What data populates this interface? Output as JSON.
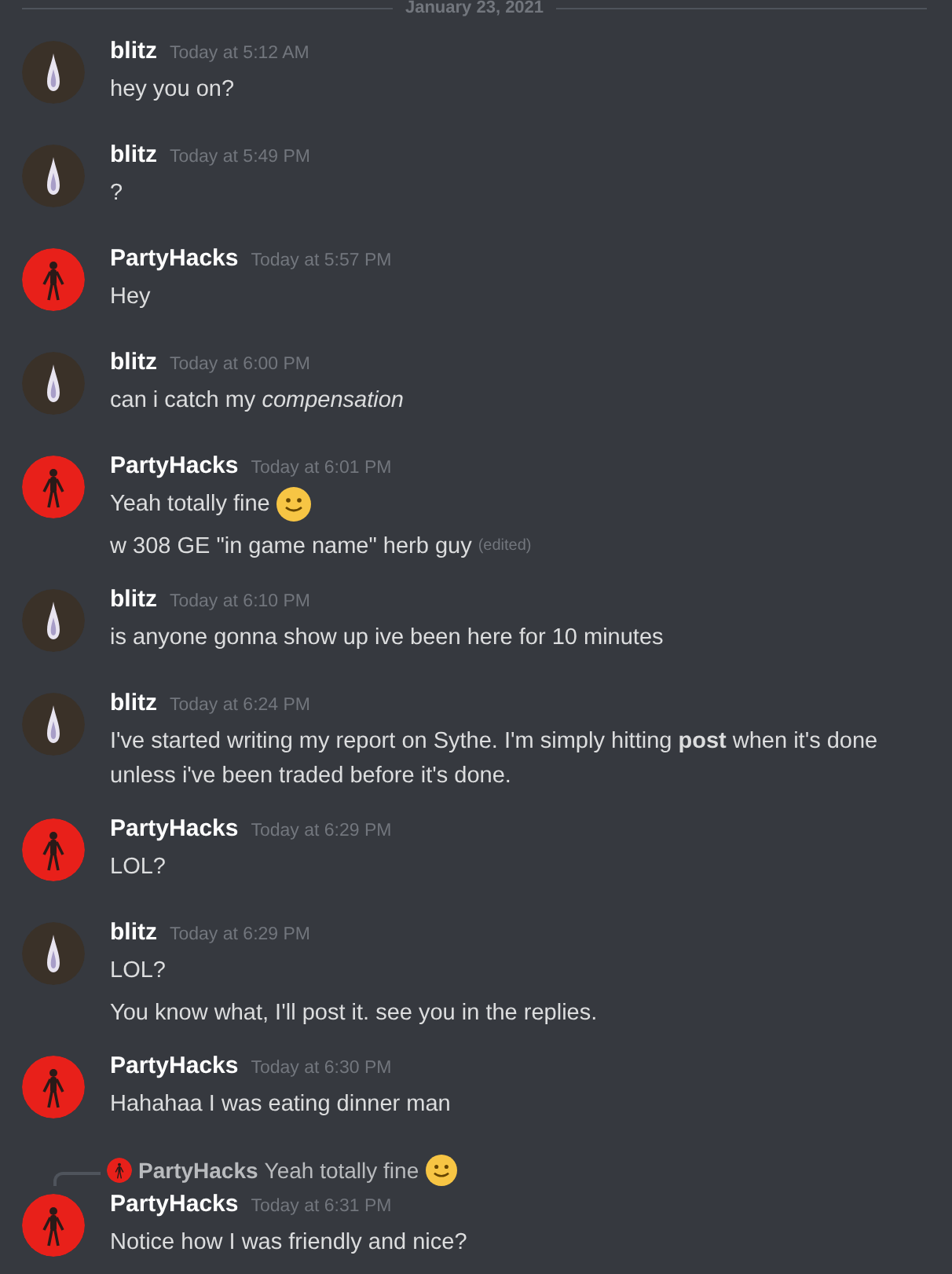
{
  "date_divider": "January 23, 2021",
  "messages": [
    {
      "author": "blitz",
      "avatar": {
        "kind": "flame"
      },
      "time": "Today at 5:12 AM",
      "lines": [
        {
          "text": "hey you on?",
          "emoji": false
        }
      ]
    },
    {
      "author": "blitz",
      "avatar": {
        "kind": "flame"
      },
      "time": "Today at 5:49 PM",
      "lines": [
        {
          "text": "?",
          "emoji": false
        }
      ]
    },
    {
      "author": "PartyHacks",
      "avatar": {
        "kind": "skeleton"
      },
      "time": "Today at 5:57 PM",
      "lines": [
        {
          "text": "Hey",
          "emoji": false
        }
      ]
    },
    {
      "author": "blitz",
      "avatar": {
        "kind": "flame"
      },
      "time": "Today at 6:00 PM",
      "lines": [
        {
          "text": "can i catch my *compensation*",
          "emoji": false
        }
      ]
    },
    {
      "author": "PartyHacks",
      "avatar": {
        "kind": "skeleton"
      },
      "time": "Today at 6:01 PM",
      "lines": [
        {
          "text": "Yeah totally fine",
          "emoji": true
        },
        {
          "text": "w 308 GE \"in game name\" herb guy",
          "emoji": false,
          "edited": "(edited)"
        }
      ]
    },
    {
      "author": "blitz",
      "avatar": {
        "kind": "flame"
      },
      "time": "Today at 6:10 PM",
      "lines": [
        {
          "text": "is anyone gonna show up ive been here for 10 minutes",
          "emoji": false
        }
      ]
    },
    {
      "author": "blitz",
      "avatar": {
        "kind": "flame"
      },
      "time": "Today at 6:24 PM",
      "lines": [
        {
          "text": "I've started writing my report on Sythe. I'm simply hitting **post** when it's done unless i've been traded before it's done.",
          "emoji": false
        }
      ]
    },
    {
      "author": "PartyHacks",
      "avatar": {
        "kind": "skeleton"
      },
      "time": "Today at 6:29 PM",
      "lines": [
        {
          "text": "LOL?",
          "emoji": false
        }
      ]
    },
    {
      "author": "blitz",
      "avatar": {
        "kind": "flame"
      },
      "time": "Today at 6:29 PM",
      "lines": [
        {
          "text": "LOL?",
          "emoji": false
        },
        {
          "text": "You know what, I'll post it. see you in the replies.",
          "emoji": false
        }
      ]
    },
    {
      "author": "PartyHacks",
      "avatar": {
        "kind": "skeleton"
      },
      "time": "Today at 6:30 PM",
      "lines": [
        {
          "text": "Hahahaa I was eating dinner man",
          "emoji": false
        }
      ]
    },
    {
      "author": "PartyHacks",
      "avatar": {
        "kind": "skeleton"
      },
      "time": "Today at 6:31 PM",
      "reply": {
        "author": "PartyHacks",
        "avatar": {
          "kind": "skeleton"
        },
        "text": "Yeah totally fine",
        "emoji": true
      },
      "lines": [
        {
          "text": "Notice how I was friendly and nice?",
          "emoji": false
        }
      ]
    }
  ]
}
